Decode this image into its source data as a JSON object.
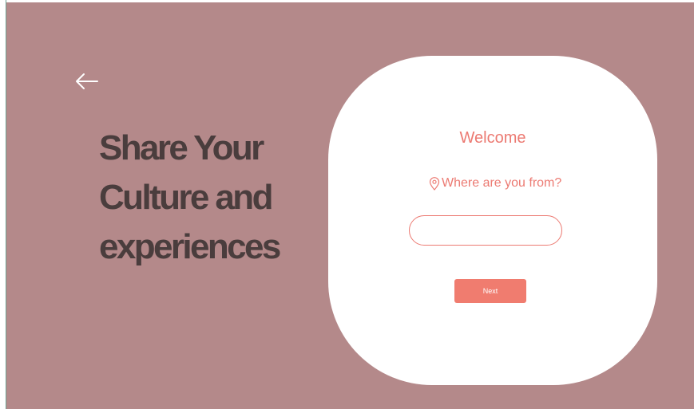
{
  "colors": {
    "background": "#b4898a",
    "card": "#ffffff",
    "accent": "#ec7a72",
    "button": "#f07c6f",
    "headline_text": "#4a3d3d"
  },
  "nav": {
    "back_icon": "arrow-left-icon"
  },
  "hero": {
    "line1": "Share Your",
    "line2": "Culture and",
    "line3": "experiences"
  },
  "form": {
    "title": "Welcome",
    "question_icon": "location-pin-icon",
    "question": "Where are you from?",
    "input_value": "",
    "input_placeholder": "",
    "next_label": "Next"
  }
}
